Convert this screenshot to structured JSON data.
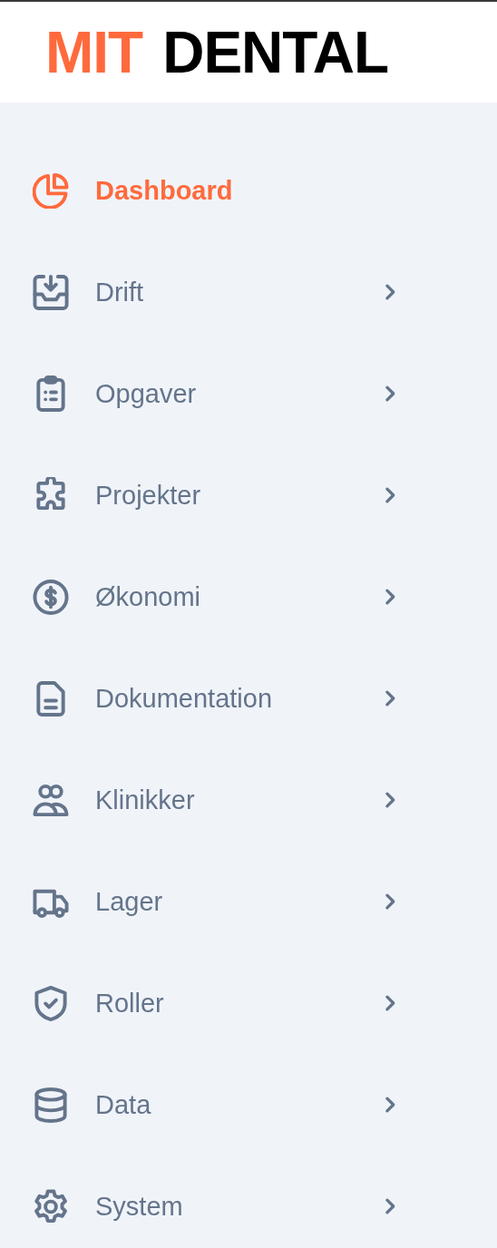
{
  "logo": {
    "part_1": "MIT",
    "part_2": "DENTAL"
  },
  "menu": [
    {
      "label": "Dashboard",
      "selected": true,
      "has_submenu": false
    },
    {
      "label": "Drift",
      "selected": false,
      "has_submenu": true
    },
    {
      "label": "Opgaver",
      "selected": false,
      "has_submenu": true
    },
    {
      "label": "Projekter",
      "selected": false,
      "has_submenu": true
    },
    {
      "label": "Økonomi",
      "selected": false,
      "has_submenu": true
    },
    {
      "label": "Dokumentation",
      "selected": false,
      "has_submenu": true
    },
    {
      "label": "Klinikker",
      "selected": false,
      "has_submenu": true
    },
    {
      "label": "Lager",
      "selected": false,
      "has_submenu": true
    },
    {
      "label": "Roller",
      "selected": false,
      "has_submenu": true
    },
    {
      "label": "Data",
      "selected": false,
      "has_submenu": true
    },
    {
      "label": "System",
      "selected": false,
      "has_submenu": true
    }
  ]
}
